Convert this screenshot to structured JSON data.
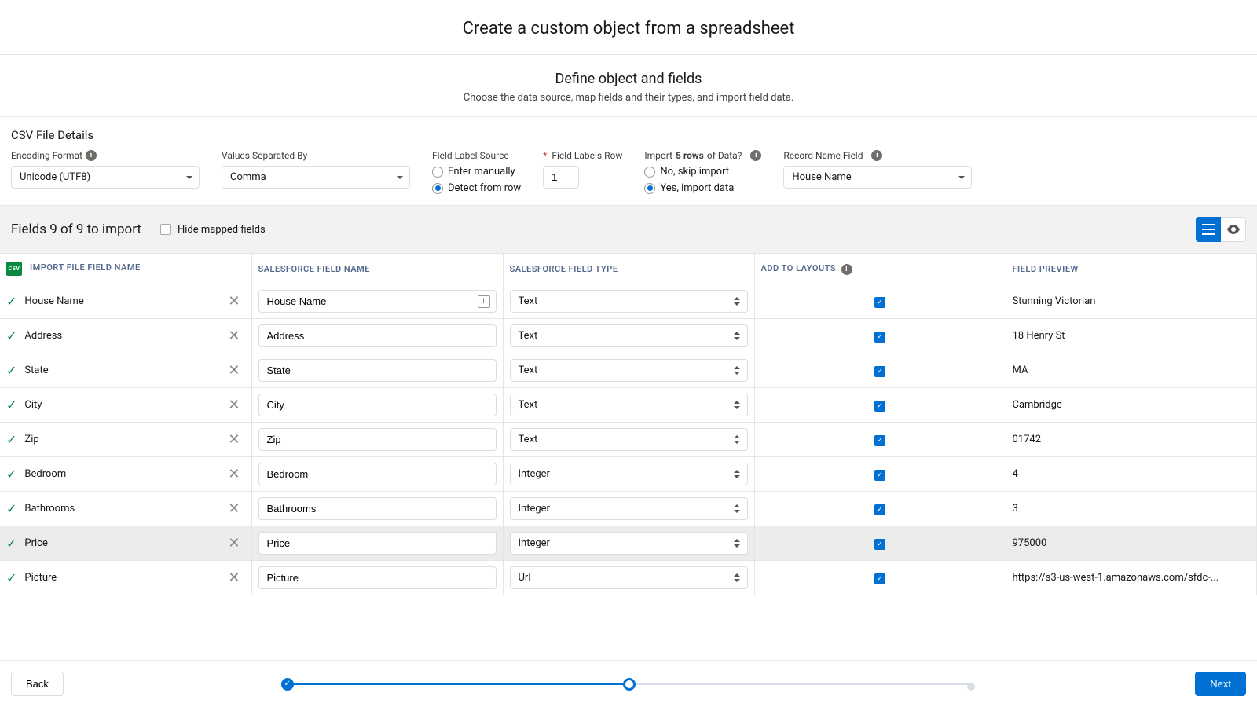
{
  "header": {
    "title": "Create a custom object from a spreadsheet"
  },
  "section": {
    "title": "Define object and fields",
    "subtitle": "Choose the data source, map fields and their types, and import field data."
  },
  "csv": {
    "title": "CSV File Details",
    "encoding_label": "Encoding Format",
    "encoding_value": "Unicode (UTF8)",
    "separator_label": "Values Separated By",
    "separator_value": "Comma",
    "field_label_source_label": "Field Label Source",
    "field_source_manual": "Enter manually",
    "field_source_detect": "Detect from row",
    "labels_row_label": "Field Labels Row",
    "labels_row_value": "1",
    "import_label_pre": "Import ",
    "import_label_bold": "5 rows",
    "import_label_post": " of Data?",
    "import_no": "No, skip import",
    "import_yes": "Yes, import data",
    "record_name_label": "Record Name Field",
    "record_name_value": "House Name"
  },
  "fields_bar": {
    "count": "Fields 9 of 9 to import",
    "hide_label": "Hide mapped fields"
  },
  "table": {
    "h_import": "IMPORT FILE FIELD NAME",
    "h_name": "SALESFORCE FIELD NAME",
    "h_type": "SALESFORCE FIELD TYPE",
    "h_layout": "ADD TO LAYOUTS",
    "h_preview": "FIELD PREVIEW",
    "csv_badge": "csv",
    "rows": [
      {
        "import": "House Name",
        "name": "House Name",
        "type": "Text",
        "preview": "Stunning Victorian",
        "has_icon": true
      },
      {
        "import": "Address",
        "name": "Address",
        "type": "Text",
        "preview": "18 Henry St"
      },
      {
        "import": "State",
        "name": "State",
        "type": "Text",
        "preview": "MA"
      },
      {
        "import": "City",
        "name": "City",
        "type": "Text",
        "preview": "Cambridge"
      },
      {
        "import": "Zip",
        "name": "Zip",
        "type": "Text",
        "preview": "01742"
      },
      {
        "import": "Bedroom",
        "name": "Bedroom",
        "type": "Integer",
        "preview": "4"
      },
      {
        "import": "Bathrooms",
        "name": "Bathrooms",
        "type": "Integer",
        "preview": "3"
      },
      {
        "import": "Price",
        "name": "Price",
        "type": "Integer",
        "preview": "975000",
        "highlighted": true
      },
      {
        "import": "Picture",
        "name": "Picture",
        "type": "Url",
        "preview": "https://s3-us-west-1.amazonaws.com/sfdc-..."
      }
    ]
  },
  "footer": {
    "back": "Back",
    "next": "Next"
  }
}
